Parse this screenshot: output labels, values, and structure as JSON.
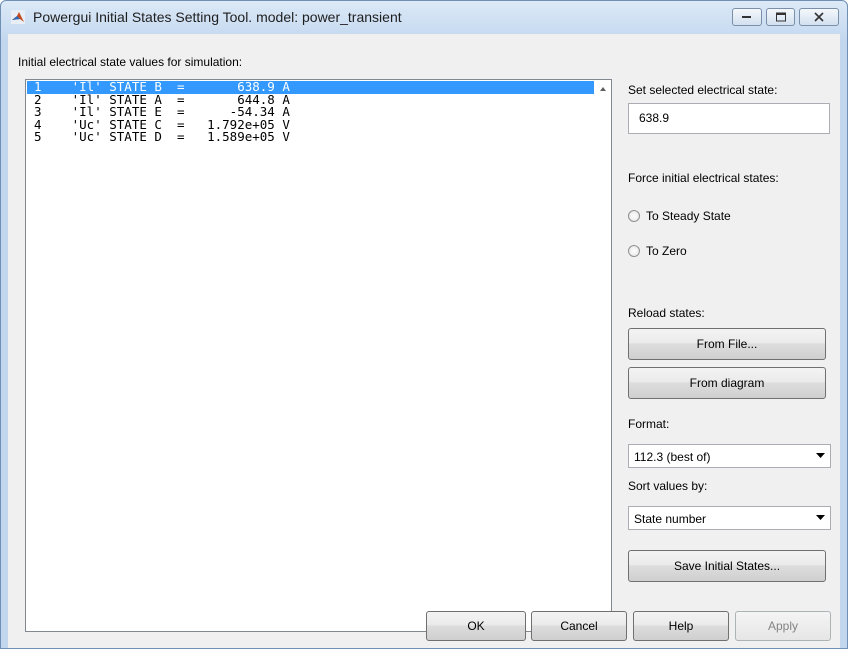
{
  "window": {
    "title": "Powergui Initial States Setting Tool.  model: power_transient"
  },
  "list": {
    "caption": "Initial electrical state values for simulation:",
    "rows": [
      "1    'Il' STATE B  =       638.9 A",
      "2    'Il' STATE A  =       644.8 A",
      "3    'Il' STATE E  =      -54.34 A",
      "4    'Uc' STATE C  =   1.792e+05 V",
      "5    'Uc' STATE D  =   1.589e+05 V"
    ],
    "selected_index": 0
  },
  "set_state": {
    "label": "Set selected electrical state:",
    "value": "638.9"
  },
  "force": {
    "label": "Force initial electrical states:",
    "steady_label": "To Steady State",
    "zero_label": "To Zero"
  },
  "reload": {
    "label": "Reload states:",
    "from_file_label": "From File...",
    "from_diagram_label": "From diagram"
  },
  "format": {
    "label": "Format:",
    "value": "112.3 (best of)"
  },
  "sort": {
    "label": "Sort values by:",
    "value": "State number"
  },
  "save_label": "Save Initial States...",
  "footer": {
    "ok_label": "OK",
    "cancel_label": "Cancel",
    "help_label": "Help",
    "apply_label": "Apply"
  },
  "colors": {
    "selection": "#3399ff",
    "window_frame": "#c2d6ee",
    "client_bg": "#f0f0f0"
  }
}
